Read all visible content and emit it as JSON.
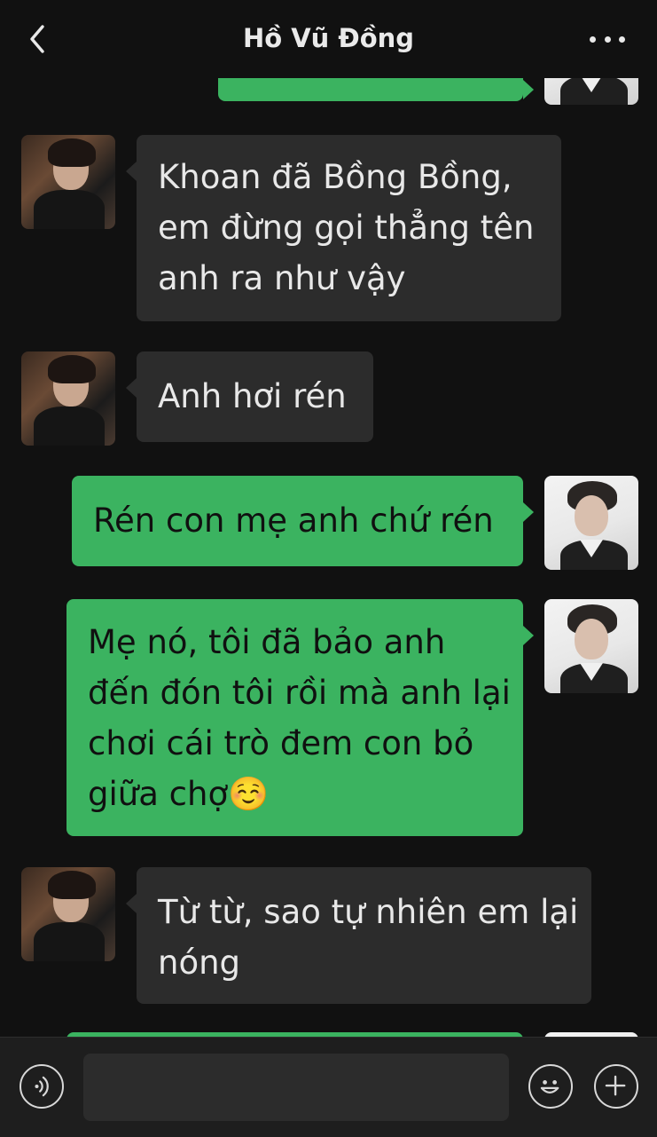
{
  "header": {
    "title": "Hồ Vũ Đồng",
    "back_icon": "chevron-left-icon",
    "more_icon": "more-horizontal-icon"
  },
  "messages": [
    {
      "side": "right",
      "text": "",
      "partial": true
    },
    {
      "side": "left",
      "text": "Khoan đã Bồng Bồng,\nem đừng gọi thẳng tên\nanh ra như vậy"
    },
    {
      "side": "left",
      "text": "Anh hơi rén"
    },
    {
      "side": "right",
      "text": "Rén con mẹ anh chứ rén"
    },
    {
      "side": "right",
      "text": "Mẹ nó, tôi đã bảo anh\nđến đón tôi rồi mà anh lại\nchơi cái trò đem con bỏ\ngiữa chợ☺️"
    },
    {
      "side": "left",
      "text": "Từ từ, sao tự nhiên em lại\nnóng"
    },
    {
      "side": "right",
      "text": "",
      "partial": true
    }
  ],
  "footer": {
    "voice_icon": "voice-icon",
    "emoji_icon": "emoji-icon",
    "plus_icon": "plus-circle-icon",
    "input_value": ""
  },
  "colors": {
    "background": "#111111",
    "incoming_bubble": "#2c2c2c",
    "outgoing_bubble": "#3bb360",
    "footer": "#1e1e1e"
  }
}
